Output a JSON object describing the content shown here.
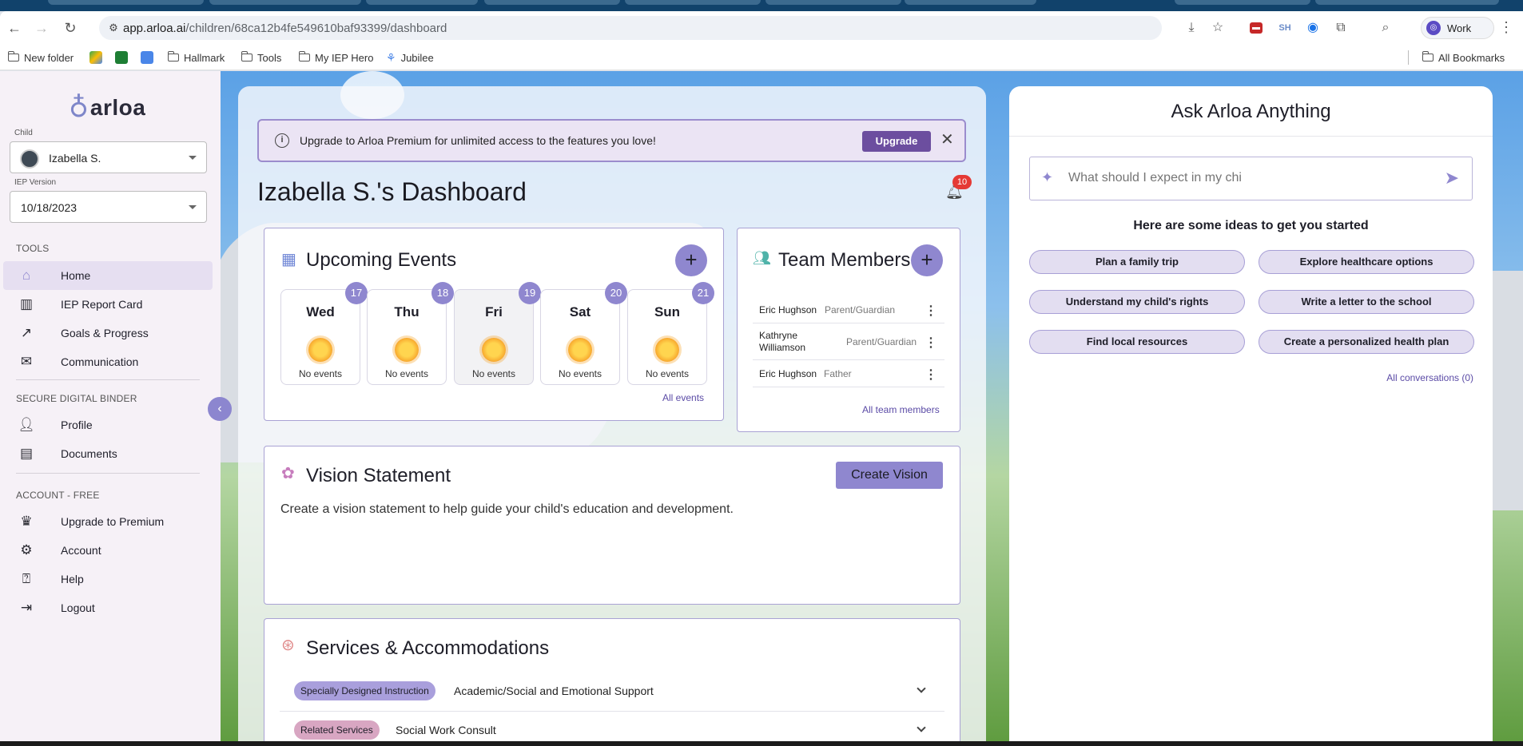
{
  "browser": {
    "url_host": "app.arloa.ai",
    "url_path": "/children/68ca12b4fe549610baf93399/dashboard",
    "profile_label": "Work",
    "ext_sh_label": "SH",
    "bookmarks": [
      "New folder",
      "Hallmark",
      "Tools",
      "My IEP Hero",
      "Jubilee"
    ],
    "all_bookmarks": "All Bookmarks"
  },
  "sidebar": {
    "logo_text": "arloa",
    "child_label": "Child",
    "child_value": "Izabella S.",
    "iep_label": "IEP Version",
    "iep_value": "10/18/2023",
    "tools_label": "TOOLS",
    "tools": [
      "Home",
      "IEP Report Card",
      "Goals & Progress",
      "Communication"
    ],
    "binder_label": "SECURE DIGITAL BINDER",
    "binder": [
      "Profile",
      "Documents"
    ],
    "account_label": "ACCOUNT - FREE",
    "account": [
      "Upgrade to Premium",
      "Account",
      "Help",
      "Logout"
    ]
  },
  "banner": {
    "message": "Upgrade to Arloa Premium for unlimited access to the features you love!",
    "button": "Upgrade"
  },
  "dashboard": {
    "title": "Izabella S.'s Dashboard",
    "notification_count": "10"
  },
  "events": {
    "title": "Upcoming Events",
    "days": [
      {
        "name": "Wed",
        "date": "17",
        "text": "No events"
      },
      {
        "name": "Thu",
        "date": "18",
        "text": "No events"
      },
      {
        "name": "Fri",
        "date": "19",
        "text": "No events"
      },
      {
        "name": "Sat",
        "date": "20",
        "text": "No events"
      },
      {
        "name": "Sun",
        "date": "21",
        "text": "No events"
      }
    ],
    "all_link": "All events"
  },
  "team": {
    "title": "Team Members",
    "members": [
      {
        "name": "Eric Hughson",
        "role": "Parent/Guardian"
      },
      {
        "name": "Kathryne Williamson",
        "role": "Parent/Guardian"
      },
      {
        "name": "Eric Hughson",
        "role": "Father"
      }
    ],
    "all_link": "All team members"
  },
  "vision": {
    "title": "Vision Statement",
    "button": "Create Vision",
    "text": "Create a vision statement to help guide your child's education and development."
  },
  "services": {
    "title": "Services & Accommodations",
    "items": [
      {
        "tag": "Specially Designed Instruction",
        "label": "Academic/Social and Emotional Support",
        "color": "#a99fdc"
      },
      {
        "tag": "Related Services",
        "label": "Social Work Consult",
        "color": "#d8a6c2"
      }
    ]
  },
  "ask": {
    "title": "Ask Arloa Anything",
    "placeholder": "What should I expect in my chi",
    "ideas_heading": "Here are some ideas to get you started",
    "ideas": [
      "Plan a family trip",
      "Explore healthcare options",
      "Understand my child's rights",
      "Write a letter to the school",
      "Find local resources",
      "Create a personalized health plan"
    ],
    "all_conversations": "All conversations (0)"
  },
  "colors": {
    "accent": "#8f87cf",
    "sidebar_bg": "#f6f1f7",
    "banner_button": "#6c4e9f",
    "badge": "#e53935"
  }
}
